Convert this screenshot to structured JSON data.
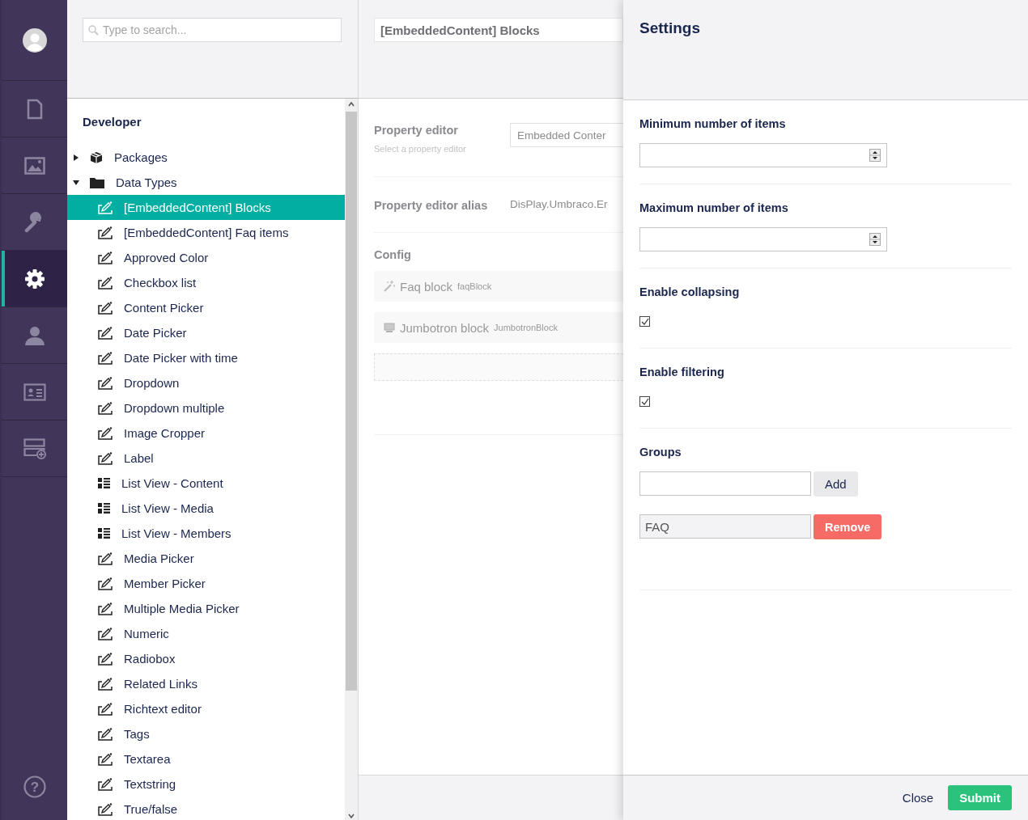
{
  "nav": {
    "items": [
      {
        "kind": "avatar",
        "selected": false
      },
      {
        "kind": "document",
        "selected": false
      },
      {
        "kind": "image",
        "selected": false
      },
      {
        "kind": "wrench",
        "selected": false
      },
      {
        "kind": "gear",
        "selected": true
      },
      {
        "kind": "person",
        "selected": false
      },
      {
        "kind": "card",
        "selected": false
      },
      {
        "kind": "form",
        "selected": false
      },
      {
        "kind": "help",
        "selected": false,
        "glyph": "?"
      }
    ]
  },
  "tree": {
    "search": {
      "placeholder": "Type to search..."
    },
    "heading": "Developer",
    "nodes": [
      {
        "label": "Packages",
        "kind": "package",
        "expanded": false,
        "selected": false
      },
      {
        "label": "Data Types",
        "kind": "folder",
        "expanded": true,
        "selected": false,
        "children": [
          {
            "label": "[EmbeddedContent] Blocks",
            "kind": "edit",
            "selected": true
          },
          {
            "label": "[EmbeddedContent] Faq items",
            "kind": "edit",
            "selected": false
          },
          {
            "label": "Approved Color",
            "kind": "edit",
            "selected": false
          },
          {
            "label": "Checkbox list",
            "kind": "edit",
            "selected": false
          },
          {
            "label": "Content Picker",
            "kind": "edit",
            "selected": false
          },
          {
            "label": "Date Picker",
            "kind": "edit",
            "selected": false
          },
          {
            "label": "Date Picker with time",
            "kind": "edit",
            "selected": false
          },
          {
            "label": "Dropdown",
            "kind": "edit",
            "selected": false
          },
          {
            "label": "Dropdown multiple",
            "kind": "edit",
            "selected": false
          },
          {
            "label": "Image Cropper",
            "kind": "edit",
            "selected": false
          },
          {
            "label": "Label",
            "kind": "edit",
            "selected": false
          },
          {
            "label": "List View - Content",
            "kind": "list",
            "selected": false
          },
          {
            "label": "List View - Media",
            "kind": "list",
            "selected": false
          },
          {
            "label": "List View - Members",
            "kind": "list",
            "selected": false
          },
          {
            "label": "Media Picker",
            "kind": "edit",
            "selected": false
          },
          {
            "label": "Member Picker",
            "kind": "edit",
            "selected": false
          },
          {
            "label": "Multiple Media Picker",
            "kind": "edit",
            "selected": false
          },
          {
            "label": "Numeric",
            "kind": "edit",
            "selected": false
          },
          {
            "label": "Radiobox",
            "kind": "edit",
            "selected": false
          },
          {
            "label": "Related Links",
            "kind": "edit",
            "selected": false
          },
          {
            "label": "Richtext editor",
            "kind": "edit",
            "selected": false
          },
          {
            "label": "Tags",
            "kind": "edit",
            "selected": false
          },
          {
            "label": "Textarea",
            "kind": "edit",
            "selected": false
          },
          {
            "label": "Textstring",
            "kind": "edit",
            "selected": false
          },
          {
            "label": "True/false",
            "kind": "edit",
            "selected": false
          }
        ]
      }
    ]
  },
  "editor": {
    "name": "[EmbeddedContent] Blocks",
    "property_editor": {
      "label": "Property editor",
      "description": "Select a property editor",
      "value": "Embedded Conter"
    },
    "alias": {
      "label": "Property editor alias",
      "value": "DisPlay.Umbraco.Er"
    },
    "config": {
      "label": "Config",
      "blocks": [
        {
          "name": "Faq block",
          "alias": "faqBlock",
          "kind": "wand"
        },
        {
          "name": "Jumbotron block",
          "alias": "JumbotronBlock",
          "kind": "monitor"
        }
      ]
    }
  },
  "settings": {
    "title": "Settings",
    "fields": [
      {
        "kind": "number",
        "label": "Minimum number of items"
      },
      {
        "kind": "number",
        "label": "Maximum number of items"
      },
      {
        "kind": "checkbox",
        "label": "Enable collapsing",
        "checked": true
      },
      {
        "kind": "checkbox",
        "label": "Enable filtering",
        "checked": true
      },
      {
        "kind": "groups",
        "label": "Groups",
        "add_button": "Add",
        "items": [
          {
            "value": "FAQ",
            "remove_button": "Remove"
          }
        ]
      }
    ],
    "close_button": "Close",
    "submit_button": "Submit"
  }
}
